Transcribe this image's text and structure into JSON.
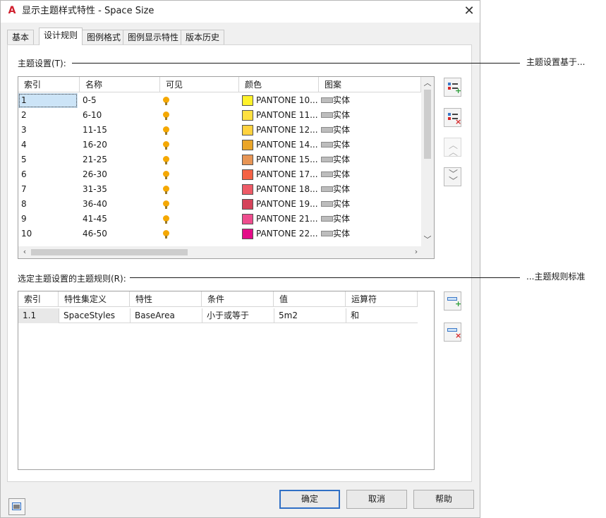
{
  "dialog": {
    "title": "显示主题样式特性 - Space Size",
    "close_glyph": "✕",
    "app_icon": "autocad-a-icon",
    "app_letter": "A"
  },
  "tabs": [
    {
      "label": "基本",
      "active": false
    },
    {
      "label": "设计规则",
      "active": true
    },
    {
      "label": "图例格式",
      "active": false
    },
    {
      "label": "图例显示特性",
      "active": false
    },
    {
      "label": "版本历史",
      "active": false
    }
  ],
  "theme_settings": {
    "label": "主题设置(T):",
    "columns": [
      "索引",
      "名称",
      "可见",
      "颜色",
      "图案"
    ],
    "rows": [
      {
        "index": "1",
        "name": "0-5",
        "color": "PANTONE 10...",
        "hex": "#fff22a",
        "pattern": "实体",
        "selected": true
      },
      {
        "index": "2",
        "name": "6-10",
        "color": "PANTONE 11...",
        "hex": "#ffe040",
        "pattern": "实体"
      },
      {
        "index": "3",
        "name": "11-15",
        "color": "PANTONE 12...",
        "hex": "#ffd23f",
        "pattern": "实体"
      },
      {
        "index": "4",
        "name": "16-20",
        "color": "PANTONE 14...",
        "hex": "#eaa529",
        "pattern": "实体"
      },
      {
        "index": "5",
        "name": "21-25",
        "color": "PANTONE 15...",
        "hex": "#e79555",
        "pattern": "实体"
      },
      {
        "index": "6",
        "name": "26-30",
        "color": "PANTONE 17...",
        "hex": "#f46245",
        "pattern": "实体"
      },
      {
        "index": "7",
        "name": "31-35",
        "color": "PANTONE 18...",
        "hex": "#ee5b67",
        "pattern": "实体"
      },
      {
        "index": "8",
        "name": "36-40",
        "color": "PANTONE 19...",
        "hex": "#d5435a",
        "pattern": "实体"
      },
      {
        "index": "9",
        "name": "41-45",
        "color": "PANTONE 21...",
        "hex": "#ee4d8e",
        "pattern": "实体"
      },
      {
        "index": "10",
        "name": "46-50",
        "color": "PANTONE 22...",
        "hex": "#e40c88",
        "pattern": "实体"
      }
    ]
  },
  "theme_rules": {
    "label": "选定主题设置的主题规则(R):",
    "columns": [
      "索引",
      "特性集定义",
      "特性",
      "条件",
      "值",
      "运算符"
    ],
    "rows": [
      {
        "index": "1.1",
        "property_set": "SpaceStyles",
        "property": "BaseArea",
        "condition": "小于或等于",
        "value": "5m2",
        "operator": "和"
      }
    ]
  },
  "callouts": {
    "theme_settings": "主题设置基于...",
    "theme_rules": "...主题规则标准"
  },
  "buttons": {
    "ok": "确定",
    "cancel": "取消",
    "help": "帮助"
  },
  "icons": {
    "add_setting": "add-list-item-icon",
    "remove_setting": "remove-list-item-icon",
    "move_up": "double-chevron-up-icon",
    "move_down": "double-chevron-down-icon",
    "add_rule": "add-rule-icon",
    "remove_rule": "remove-rule-icon",
    "corner": "display-manager-icon"
  }
}
